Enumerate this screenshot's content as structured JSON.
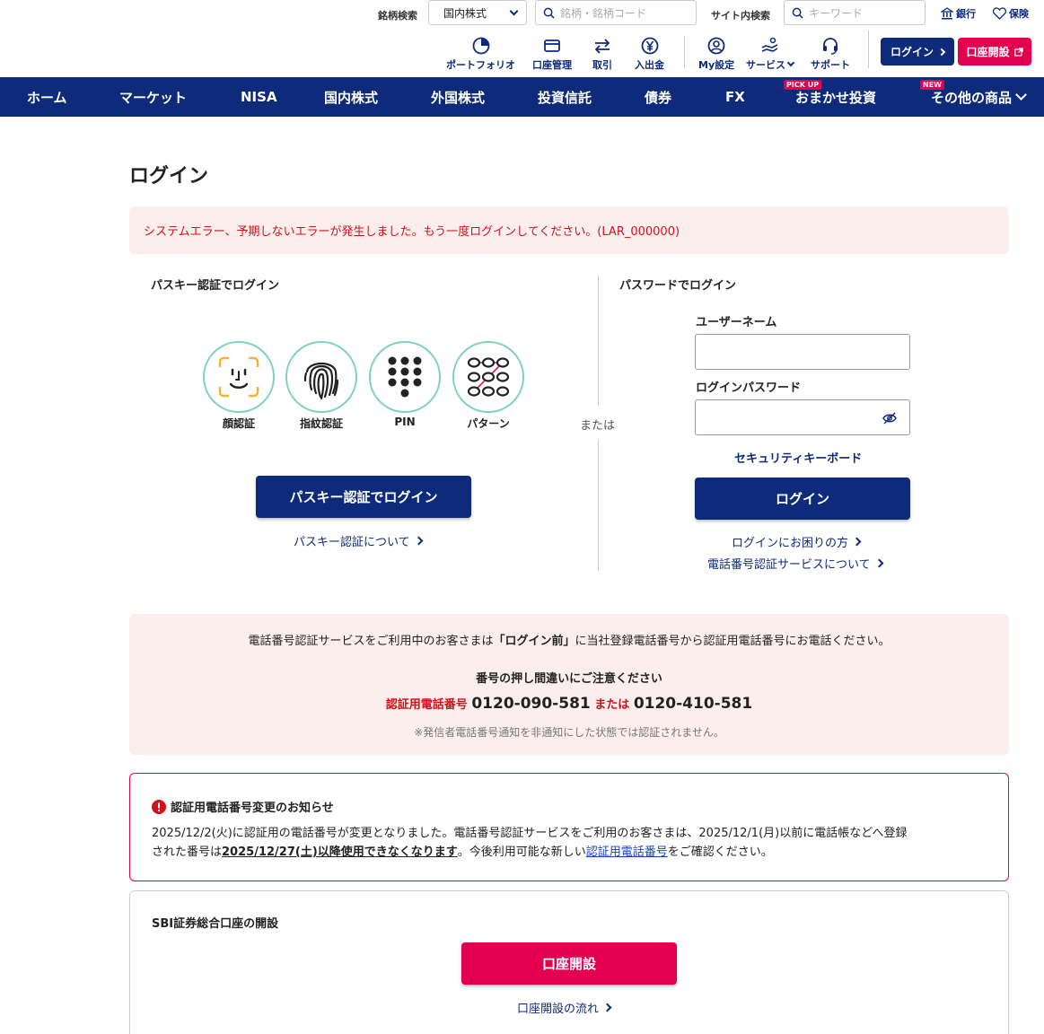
{
  "header": {
    "stock_search_label": "銘柄検索",
    "stock_type_select": "国内株式",
    "stock_search_placeholder": "銘柄・銘柄コード",
    "site_search_label": "サイト内検索",
    "site_search_placeholder": "キーワード",
    "bank_link": "銀行",
    "insurance_link": "保険",
    "tools": [
      {
        "label": "ポートフォリオ",
        "icon": "portfolio-icon"
      },
      {
        "label": "口座管理",
        "icon": "card-icon"
      },
      {
        "label": "取引",
        "icon": "exchange-icon"
      },
      {
        "label": "入出金",
        "icon": "yen-icon"
      },
      {
        "label": "My設定",
        "icon": "user-icon"
      },
      {
        "label": "サービス",
        "icon": "service-icon"
      },
      {
        "label": "サポート",
        "icon": "headset-icon"
      }
    ],
    "login_button": "ログイン",
    "open_account_button": "口座開設"
  },
  "nav": {
    "items": [
      "ホーム",
      "マーケット",
      "NISA",
      "国内株式",
      "外国株式",
      "投資信託",
      "債券",
      "FX",
      "おまかせ投資",
      "その他の商品"
    ],
    "badge_pickup": "PICK UP",
    "badge_new": "NEW"
  },
  "page": {
    "title": "ログイン",
    "error_message": "システムエラー、予期しないエラーが発生しました。もう一度ログインしてください。(LAR_000000)"
  },
  "passkey": {
    "section_title": "パスキー認証でログイン",
    "methods": [
      "顔認証",
      "指紋認証",
      "PIN",
      "パターン"
    ],
    "login_button": "パスキー認証でログイン",
    "about_link": "パスキー認証について"
  },
  "or_label": "または",
  "password": {
    "section_title": "パスワードでログイン",
    "username_label": "ユーザーネーム",
    "password_label": "ログインパスワード",
    "security_keyboard_link": "セキュリティキーボード",
    "login_button": "ログイン",
    "trouble_link": "ログインにお困りの方",
    "phone_auth_link": "電話番号認証サービスについて"
  },
  "phone_info": {
    "line1_pre": "電話番号認証サービスをご利用中のお客さまは",
    "line1_bold": "「ログイン前」",
    "line1_post": "に当社登録電話番号から認証用電話番号にお電話ください。",
    "caution": "番号の押し間違いにご注意ください",
    "auth_label": "認証用電話番号",
    "number1": "0120-090-581",
    "or_text": "または",
    "number2": "0120-410-581",
    "note": "※発信者電話番号通知を非通知にした状態では認証されません。"
  },
  "notice": {
    "title": "認証用電話番号変更のお知らせ",
    "text1": "2025/12/2(火)に認証用の電話番号が変更となりました。電話番号認証サービスをご利用のお客さまは、2025/12/1(月)以前に電話帳などへ登録",
    "text2_pre": "された番号は",
    "text2_bold": "2025/12/27(土)以降使用できなくなります",
    "text2_mid": "。今後利用可能な新しい",
    "text2_link": "認証用電話番号",
    "text2_post": "をご確認ください。"
  },
  "open_account": {
    "title": "SBI証券総合口座の開設",
    "button": "口座開設",
    "flow_link": "口座開設の流れ"
  },
  "colors": {
    "navy": "#0e2a7a",
    "red": "#e4004f",
    "error_red": "#d0121b",
    "pink_bg": "#fdeeee",
    "teal": "#7ed1c0"
  }
}
